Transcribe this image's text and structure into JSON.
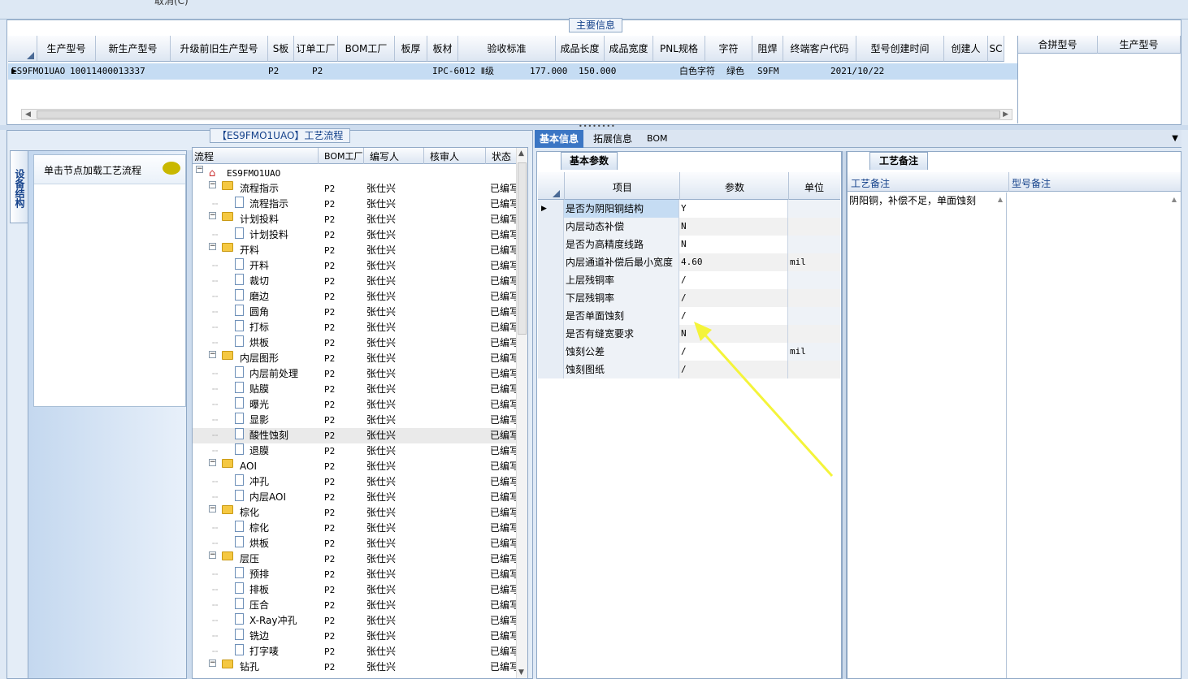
{
  "top": {
    "cut_text": "取消(C)"
  },
  "main_info": {
    "title": "主要信息",
    "columns": [
      "生产型号",
      "新生产型号",
      "升级前旧生产型号",
      "S板",
      "订单工厂",
      "BOM工厂",
      "板厚",
      "板材",
      "验收标准",
      "成品长度",
      "成品宽度",
      "PNL规格",
      "字符",
      "阻焊",
      "终端客户代码",
      "型号创建时间",
      "创建人",
      "SC"
    ],
    "row": [
      "ES9FMO1UAO",
      "10011400013337",
      "",
      "",
      "P2",
      "P2",
      "",
      "",
      "IPC-6012 Ⅱ级",
      "177.000",
      "150.000",
      "",
      "白色字符",
      "绿色",
      "S9FM",
      "2021/10/22",
      "",
      ""
    ],
    "side_columns": [
      "合拼型号",
      "生产型号"
    ]
  },
  "flow": {
    "title": "【ES9FMO1UAO】工艺流程",
    "vertical_tab": "设备结构",
    "hint": "单击节点加载工艺流程",
    "columns": [
      "流程",
      "BOM工厂",
      "编写人",
      "核审人",
      "状态"
    ],
    "root": "ES9FMO1UAO",
    "rows": [
      {
        "name": "流程指示",
        "type": "folder",
        "bom": "P2",
        "writer": "张仕兴",
        "status": "已编写"
      },
      {
        "name": "流程指示",
        "type": "doc",
        "bom": "P2",
        "writer": "张仕兴",
        "status": "已编写"
      },
      {
        "name": "计划投料",
        "type": "folder",
        "bom": "P2",
        "writer": "张仕兴",
        "status": "已编写"
      },
      {
        "name": "计划投料",
        "type": "doc",
        "bom": "P2",
        "writer": "张仕兴",
        "status": "已编写"
      },
      {
        "name": "开料",
        "type": "folder",
        "bom": "P2",
        "writer": "张仕兴",
        "status": "已编写"
      },
      {
        "name": "开料",
        "type": "doc",
        "bom": "P2",
        "writer": "张仕兴",
        "status": "已编写"
      },
      {
        "name": "裁切",
        "type": "doc",
        "bom": "P2",
        "writer": "张仕兴",
        "status": "已编写"
      },
      {
        "name": "磨边",
        "type": "doc",
        "bom": "P2",
        "writer": "张仕兴",
        "status": "已编写"
      },
      {
        "name": "圆角",
        "type": "doc",
        "bom": "P2",
        "writer": "张仕兴",
        "status": "已编写"
      },
      {
        "name": "打标",
        "type": "doc",
        "bom": "P2",
        "writer": "张仕兴",
        "status": "已编写"
      },
      {
        "name": "烘板",
        "type": "doc",
        "bom": "P2",
        "writer": "张仕兴",
        "status": "已编写"
      },
      {
        "name": "内层图形",
        "type": "folder",
        "bom": "P2",
        "writer": "张仕兴",
        "status": "已编写"
      },
      {
        "name": "内层前处理",
        "type": "doc",
        "bom": "P2",
        "writer": "张仕兴",
        "status": "已编写"
      },
      {
        "name": "贴膜",
        "type": "doc",
        "bom": "P2",
        "writer": "张仕兴",
        "status": "已编写"
      },
      {
        "name": "曝光",
        "type": "doc",
        "bom": "P2",
        "writer": "张仕兴",
        "status": "已编写"
      },
      {
        "name": "显影",
        "type": "doc",
        "bom": "P2",
        "writer": "张仕兴",
        "status": "已编写"
      },
      {
        "name": "酸性蚀刻",
        "type": "doc",
        "bom": "P2",
        "writer": "张仕兴",
        "status": "已编写",
        "selected": true
      },
      {
        "name": "退膜",
        "type": "doc",
        "bom": "P2",
        "writer": "张仕兴",
        "status": "已编写"
      },
      {
        "name": "AOI",
        "type": "folder",
        "bom": "P2",
        "writer": "张仕兴",
        "status": "已编写"
      },
      {
        "name": "冲孔",
        "type": "doc",
        "bom": "P2",
        "writer": "张仕兴",
        "status": "已编写"
      },
      {
        "name": "内层AOI",
        "type": "doc",
        "bom": "P2",
        "writer": "张仕兴",
        "status": "已编写"
      },
      {
        "name": "棕化",
        "type": "folder",
        "bom": "P2",
        "writer": "张仕兴",
        "status": "已编写"
      },
      {
        "name": "棕化",
        "type": "doc",
        "bom": "P2",
        "writer": "张仕兴",
        "status": "已编写"
      },
      {
        "name": "烘板",
        "type": "doc",
        "bom": "P2",
        "writer": "张仕兴",
        "status": "已编写"
      },
      {
        "name": "层压",
        "type": "folder",
        "bom": "P2",
        "writer": "张仕兴",
        "status": "已编写"
      },
      {
        "name": "预排",
        "type": "doc",
        "bom": "P2",
        "writer": "张仕兴",
        "status": "已编写"
      },
      {
        "name": "排板",
        "type": "doc",
        "bom": "P2",
        "writer": "张仕兴",
        "status": "已编写"
      },
      {
        "name": "压合",
        "type": "doc",
        "bom": "P2",
        "writer": "张仕兴",
        "status": "已编写"
      },
      {
        "name": "X-Ray冲孔",
        "type": "doc",
        "bom": "P2",
        "writer": "张仕兴",
        "status": "已编写"
      },
      {
        "name": "铣边",
        "type": "doc",
        "bom": "P2",
        "writer": "张仕兴",
        "status": "已编写"
      },
      {
        "name": "打字唛",
        "type": "doc",
        "bom": "P2",
        "writer": "张仕兴",
        "status": "已编写"
      },
      {
        "name": "钻孔",
        "type": "folder",
        "bom": "P2",
        "writer": "张仕兴",
        "status": "已编写"
      }
    ]
  },
  "detail": {
    "tabs": [
      "基本信息",
      "拓展信息",
      "BOM"
    ],
    "params_tab": "基本参数",
    "param_columns": [
      "项目",
      "参数",
      "单位"
    ],
    "params": [
      {
        "item": "是否为阴阳铜结构",
        "value": "Y",
        "unit": ""
      },
      {
        "item": "内层动态补偿",
        "value": "N",
        "unit": ""
      },
      {
        "item": "是否为高精度线路",
        "value": "N",
        "unit": ""
      },
      {
        "item": "内层通道补偿后最小宽度",
        "value": "4.60",
        "unit": "mil"
      },
      {
        "item": "上层残铜率",
        "value": "/",
        "unit": ""
      },
      {
        "item": "下层残铜率",
        "value": "/",
        "unit": ""
      },
      {
        "item": "是否单面蚀刻",
        "value": "/",
        "unit": ""
      },
      {
        "item": "是否有缝宽要求",
        "value": "N",
        "unit": ""
      },
      {
        "item": "蚀刻公差",
        "value": "/",
        "unit": "mil"
      },
      {
        "item": "蚀刻图纸",
        "value": "/",
        "unit": ""
      }
    ],
    "remarks_tab": "工艺备注",
    "remark_columns": [
      "工艺备注",
      "型号备注"
    ],
    "remark_text": "阴阳铜，补偿不足，单面蚀刻"
  },
  "colors": {
    "accent": "#3b76c4",
    "selection": "#c5dcf3",
    "arrow": "#f4f43a"
  }
}
